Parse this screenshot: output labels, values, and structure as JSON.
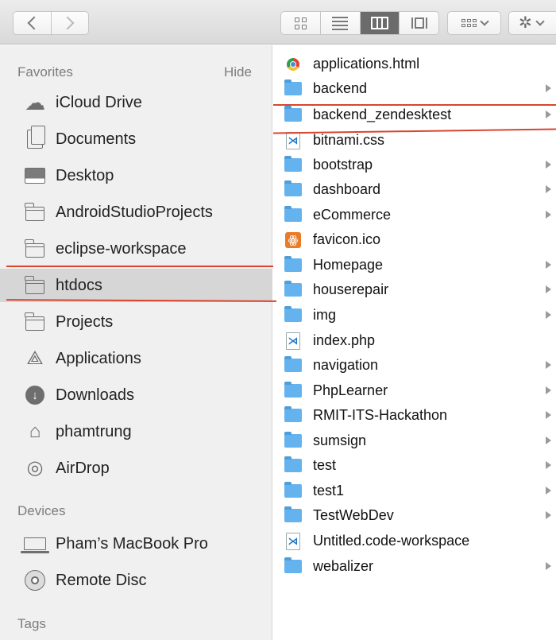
{
  "sidebar": {
    "favorites_heading": "Favorites",
    "hide_label": "Hide",
    "favorites": [
      {
        "label": "iCloud Drive",
        "icon": "cloud-icon"
      },
      {
        "label": "Documents",
        "icon": "documents-icon"
      },
      {
        "label": "Desktop",
        "icon": "desktop-icon"
      },
      {
        "label": "AndroidStudioProjects",
        "icon": "folder-icon"
      },
      {
        "label": "eclipse-workspace",
        "icon": "folder-icon"
      },
      {
        "label": "htdocs",
        "icon": "folder-icon",
        "selected": true
      },
      {
        "label": "Projects",
        "icon": "folder-icon"
      },
      {
        "label": "Applications",
        "icon": "applications-icon"
      },
      {
        "label": "Downloads",
        "icon": "downloads-icon"
      },
      {
        "label": "phamtrung",
        "icon": "home-icon"
      },
      {
        "label": "AirDrop",
        "icon": "airdrop-icon"
      }
    ],
    "devices_heading": "Devices",
    "devices": [
      {
        "label": "Pham’s MacBook Pro",
        "icon": "laptop-icon"
      },
      {
        "label": "Remote Disc",
        "icon": "disc-icon"
      }
    ],
    "tags_heading": "Tags"
  },
  "files": [
    {
      "name": "applications.html",
      "type": "chrome-file",
      "folder": false
    },
    {
      "name": "backend",
      "type": "folder",
      "folder": true
    },
    {
      "name": "backend_zendesktest",
      "type": "folder",
      "folder": true
    },
    {
      "name": "bitnami.css",
      "type": "vscode-file",
      "folder": false
    },
    {
      "name": "bootstrap",
      "type": "folder",
      "folder": true
    },
    {
      "name": "dashboard",
      "type": "folder",
      "folder": true
    },
    {
      "name": "eCommerce",
      "type": "folder",
      "folder": true
    },
    {
      "name": "favicon.ico",
      "type": "ico-file",
      "folder": false
    },
    {
      "name": "Homepage",
      "type": "folder",
      "folder": true
    },
    {
      "name": "houserepair",
      "type": "folder",
      "folder": true
    },
    {
      "name": "img",
      "type": "folder",
      "folder": true
    },
    {
      "name": "index.php",
      "type": "vscode-file",
      "folder": false
    },
    {
      "name": "navigation",
      "type": "folder",
      "folder": true
    },
    {
      "name": "PhpLearner",
      "type": "folder",
      "folder": true
    },
    {
      "name": "RMIT-ITS-Hackathon",
      "type": "folder",
      "folder": true
    },
    {
      "name": "sumsign",
      "type": "folder",
      "folder": true
    },
    {
      "name": "test",
      "type": "folder",
      "folder": true
    },
    {
      "name": "test1",
      "type": "folder",
      "folder": true
    },
    {
      "name": "TestWebDev",
      "type": "folder",
      "folder": true
    },
    {
      "name": "Untitled.code-workspace",
      "type": "vscode-file",
      "folder": false
    },
    {
      "name": "webalizer",
      "type": "folder",
      "folder": true
    }
  ],
  "toolbar": {
    "view_modes": [
      "icon-view",
      "list-view",
      "column-view",
      "cover-flow-view"
    ],
    "active_view": "column-view"
  },
  "colors": {
    "annotation_line": "#d9452e",
    "folder_blue": "#64b3ef"
  }
}
